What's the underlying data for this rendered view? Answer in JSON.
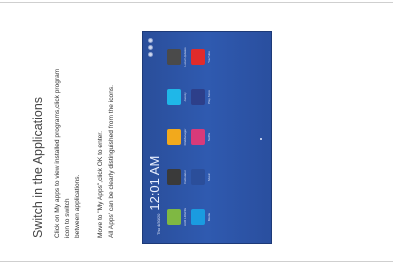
{
  "title": "Switch in the Applications",
  "lines": [
    "Click on My apps to view installed programs,click program",
    "icon to switch",
    "between applications.",
    "Move to \"My Apps\",click OK to enter.",
    "All Apps' can be clearly distinguished from the icons."
  ],
  "tv": {
    "date": "Thu 4/30/20",
    "time": "12:01 AM",
    "apps": [
      {
        "label": "AUR LIFENG",
        "icon": "photo-gallery-icon",
        "color": "#7fb843"
      },
      {
        "label": "Calculator",
        "icon": "calculator-icon",
        "color": "#3a3a3a"
      },
      {
        "label": "FileManager",
        "icon": "folder-icon",
        "color": "#f2a91c"
      },
      {
        "label": "Jooxzy",
        "icon": "app-icon",
        "color": "#1fb7e8"
      },
      {
        "label": "Local Updates",
        "icon": "update-icon",
        "color": "#4a4a4a"
      },
      {
        "label": "Media",
        "icon": "media-icon",
        "color": "#1a9be0"
      },
      {
        "label": "Music",
        "icon": "music-icon",
        "color": "#2b4e9a"
      },
      {
        "label": "Netflix",
        "icon": "netflix-icon",
        "color": "#d83a7a"
      },
      {
        "label": "Play Store",
        "icon": "play-store-icon",
        "color": "#2d3f8a"
      },
      {
        "label": "YouTube",
        "icon": "youtube-icon",
        "color": "#e02b2b"
      }
    ]
  }
}
